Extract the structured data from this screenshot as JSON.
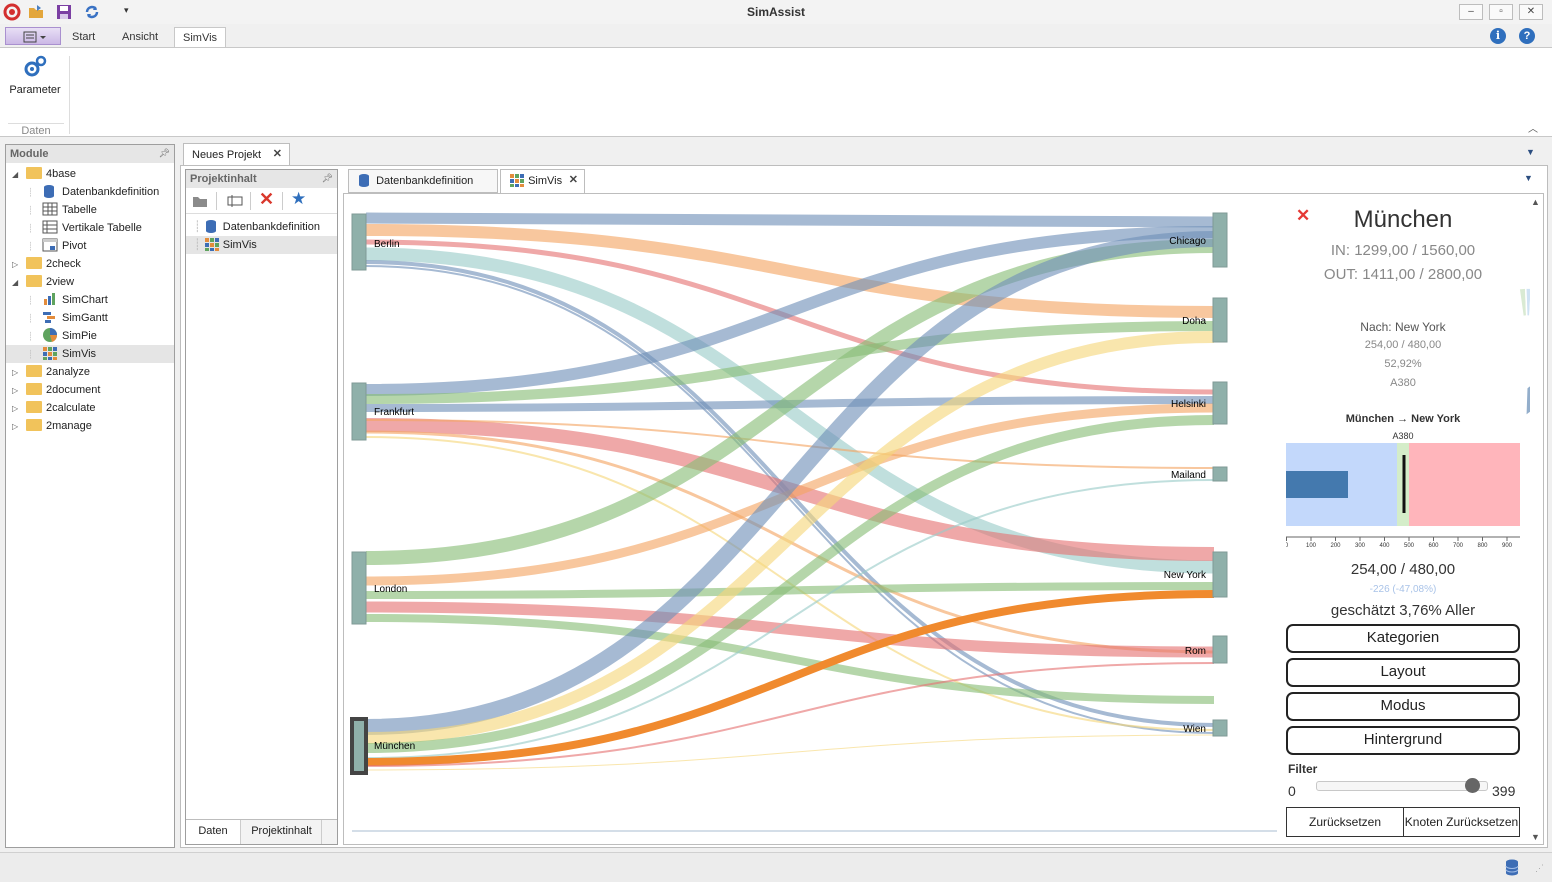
{
  "app": {
    "title": "SimAssist",
    "ribbon_tabs": [
      "Start",
      "Ansicht",
      "SimVis"
    ],
    "ribbon_button": "Parameter",
    "ribbon_group": "Daten"
  },
  "module_panel": {
    "title": "Module",
    "items": [
      {
        "label": "4base",
        "level": 0,
        "icon": "folder-icon",
        "expanded": true
      },
      {
        "label": "Datenbankdefinition",
        "level": 1,
        "icon": "database-icon"
      },
      {
        "label": "Tabelle",
        "level": 1,
        "icon": "table-icon"
      },
      {
        "label": "Vertikale Tabelle",
        "level": 1,
        "icon": "vertical-table-icon"
      },
      {
        "label": "Pivot",
        "level": 1,
        "icon": "pivot-icon"
      },
      {
        "label": "2check",
        "level": 0,
        "icon": "folder-icon",
        "expanded": false
      },
      {
        "label": "2view",
        "level": 0,
        "icon": "folder-icon",
        "expanded": true
      },
      {
        "label": "SimChart",
        "level": 1,
        "icon": "bar-chart-icon"
      },
      {
        "label": "SimGantt",
        "level": 1,
        "icon": "gantt-icon"
      },
      {
        "label": "SimPie",
        "level": 1,
        "icon": "pie-chart-icon"
      },
      {
        "label": "SimVis",
        "level": 1,
        "icon": "grid-icon",
        "selected": true
      },
      {
        "label": "2analyze",
        "level": 0,
        "icon": "folder-icon",
        "expanded": false
      },
      {
        "label": "2document",
        "level": 0,
        "icon": "folder-icon",
        "expanded": false
      },
      {
        "label": "2calculate",
        "level": 0,
        "icon": "folder-icon",
        "expanded": false
      },
      {
        "label": "2manage",
        "level": 0,
        "icon": "folder-icon",
        "expanded": false
      }
    ]
  },
  "project_tab": "Neues Projekt",
  "project_panel": {
    "title": "Projektinhalt",
    "items": [
      "Datenbankdefinition",
      "SimVis"
    ],
    "bottom_tabs": [
      "Daten",
      "Projektinhalt"
    ]
  },
  "doc_tabs": [
    "Datenbankdefinition",
    "SimVis"
  ],
  "sankey": {
    "sources": [
      "Berlin",
      "Frankfurt",
      "London",
      "München"
    ],
    "targets": [
      "Chicago",
      "Doha",
      "Helsinki",
      "Mailand",
      "New York",
      "Rom",
      "Wien"
    ]
  },
  "details": {
    "title": "München",
    "in_line": "IN: 1299,00 / 1560,00",
    "out_line": "OUT: 1411,00 / 2800,00",
    "nach": "Nach: New York",
    "values": "254,00 / 480,00",
    "percent": "52,92%",
    "aircraft": "A380",
    "route": "München → New York",
    "bar_label": "A380",
    "bar_ticks": [
      "0",
      "100",
      "200",
      "300",
      "400",
      "500",
      "600",
      "700",
      "800",
      "900"
    ],
    "value_big": "254,00 / 480,00",
    "diff": "-226 (-47,08%)",
    "estimate": "geschätzt 3,76% Aller",
    "buttons": [
      "Kategorien",
      "Layout",
      "Modus",
      "Hintergrund"
    ],
    "filter_label": "Filter",
    "filter_min": "0",
    "filter_max": "399",
    "reset": "Zurücksetzen",
    "reset_nodes": "Knoten Zurücksetzen"
  },
  "colors": {
    "blue": "#6f8fb8",
    "orange": "#f4a462",
    "red": "#e57373",
    "green": "#87bd76",
    "teal": "#99ccc8",
    "yellow": "#f5d77a",
    "highlight": "#f08a2e",
    "node": "#8fb0aa"
  }
}
